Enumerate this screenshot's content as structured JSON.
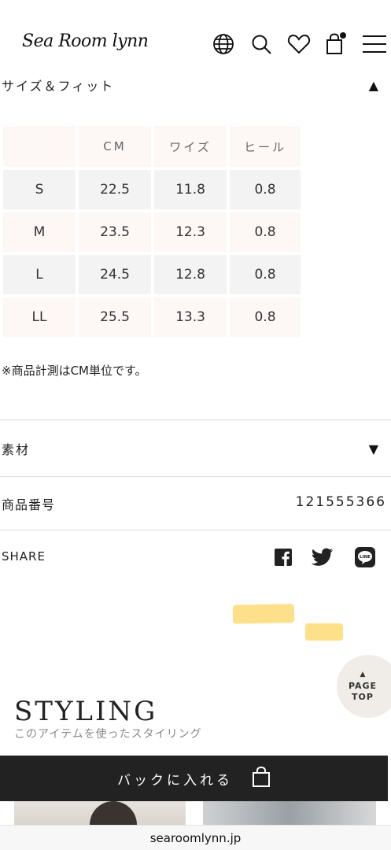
{
  "header": {
    "logo": "Sea Room lynn",
    "icons": [
      "globe-icon",
      "search-icon",
      "heart-icon",
      "cart-icon",
      "menu-icon"
    ]
  },
  "size_fit": {
    "title": "サイズ＆フィット",
    "columns": [
      "",
      "CM",
      "ワイズ",
      "ヒール"
    ],
    "rows": [
      [
        "S",
        "22.5",
        "11.8",
        "0.8"
      ],
      [
        "M",
        "23.5",
        "12.3",
        "0.8"
      ],
      [
        "L",
        "24.5",
        "12.8",
        "0.8"
      ],
      [
        "LL",
        "25.5",
        "13.3",
        "0.8"
      ]
    ],
    "note": "※商品計測はCM単位です。"
  },
  "material": {
    "label": "素材"
  },
  "product_number": {
    "label": "商品番号",
    "value": "121555366"
  },
  "share": {
    "label": "SHARE",
    "icons": [
      "facebook-icon",
      "twitter-icon",
      "line-icon"
    ]
  },
  "page_top": {
    "line1": "PAGE",
    "line2": "TOP"
  },
  "styling": {
    "title": "STYLING",
    "subtitle": "このアイテムを使ったスタイリング"
  },
  "cart_button": {
    "label": "バックに入れる"
  },
  "browser": {
    "url": "searoomlynn.jp"
  },
  "colors": {
    "accent_highlight": "#ffe08a",
    "button_bg": "#222222",
    "table_pink": "#fdf7f6",
    "table_gray": "#f4f3f3"
  }
}
